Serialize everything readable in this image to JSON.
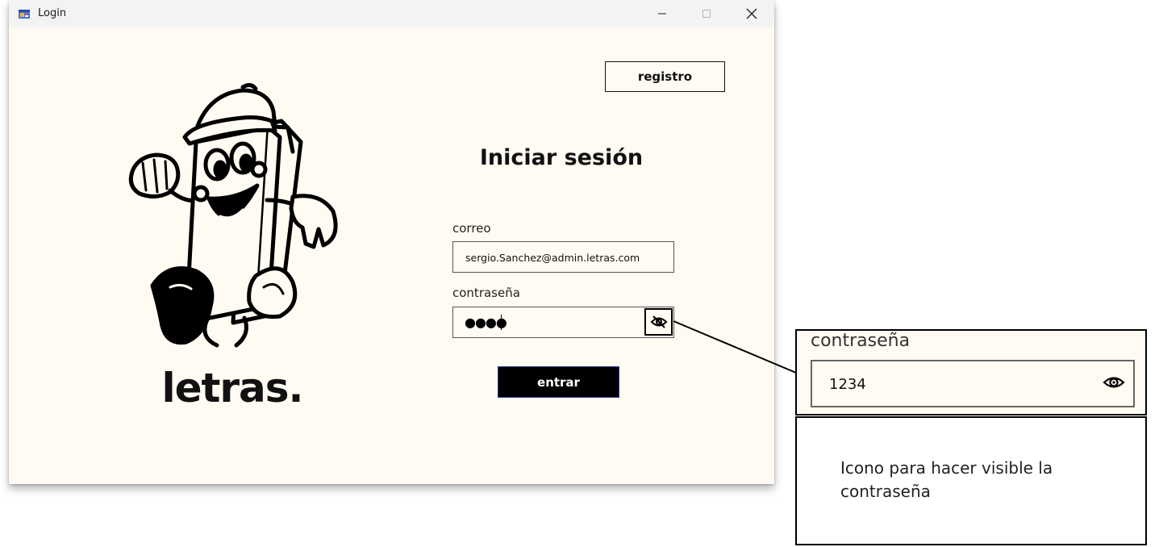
{
  "window": {
    "title": "Login",
    "controls": {
      "minimize": "minimize-icon",
      "maximize": "maximize-icon",
      "close": "close-icon"
    }
  },
  "branding": {
    "name": "letras."
  },
  "header": {
    "register_label": "registro"
  },
  "form": {
    "heading": "Iniciar sesión",
    "email_label": "correo",
    "email_value": "sergio.Sanchez@admin.letras.com",
    "password_label": "contraseña",
    "password_masked": "●●●●",
    "submit_label": "entrar"
  },
  "zoom_callout": {
    "label": "contraseña",
    "password_visible": "1234"
  },
  "note": {
    "text": "Icono para hacer visible la contraseña"
  },
  "colors": {
    "window_bg": "#fffbf2",
    "titlebar_bg": "#f3f3f3",
    "button_dark": "#000000",
    "button_border_accent": "#2b3d8f"
  }
}
